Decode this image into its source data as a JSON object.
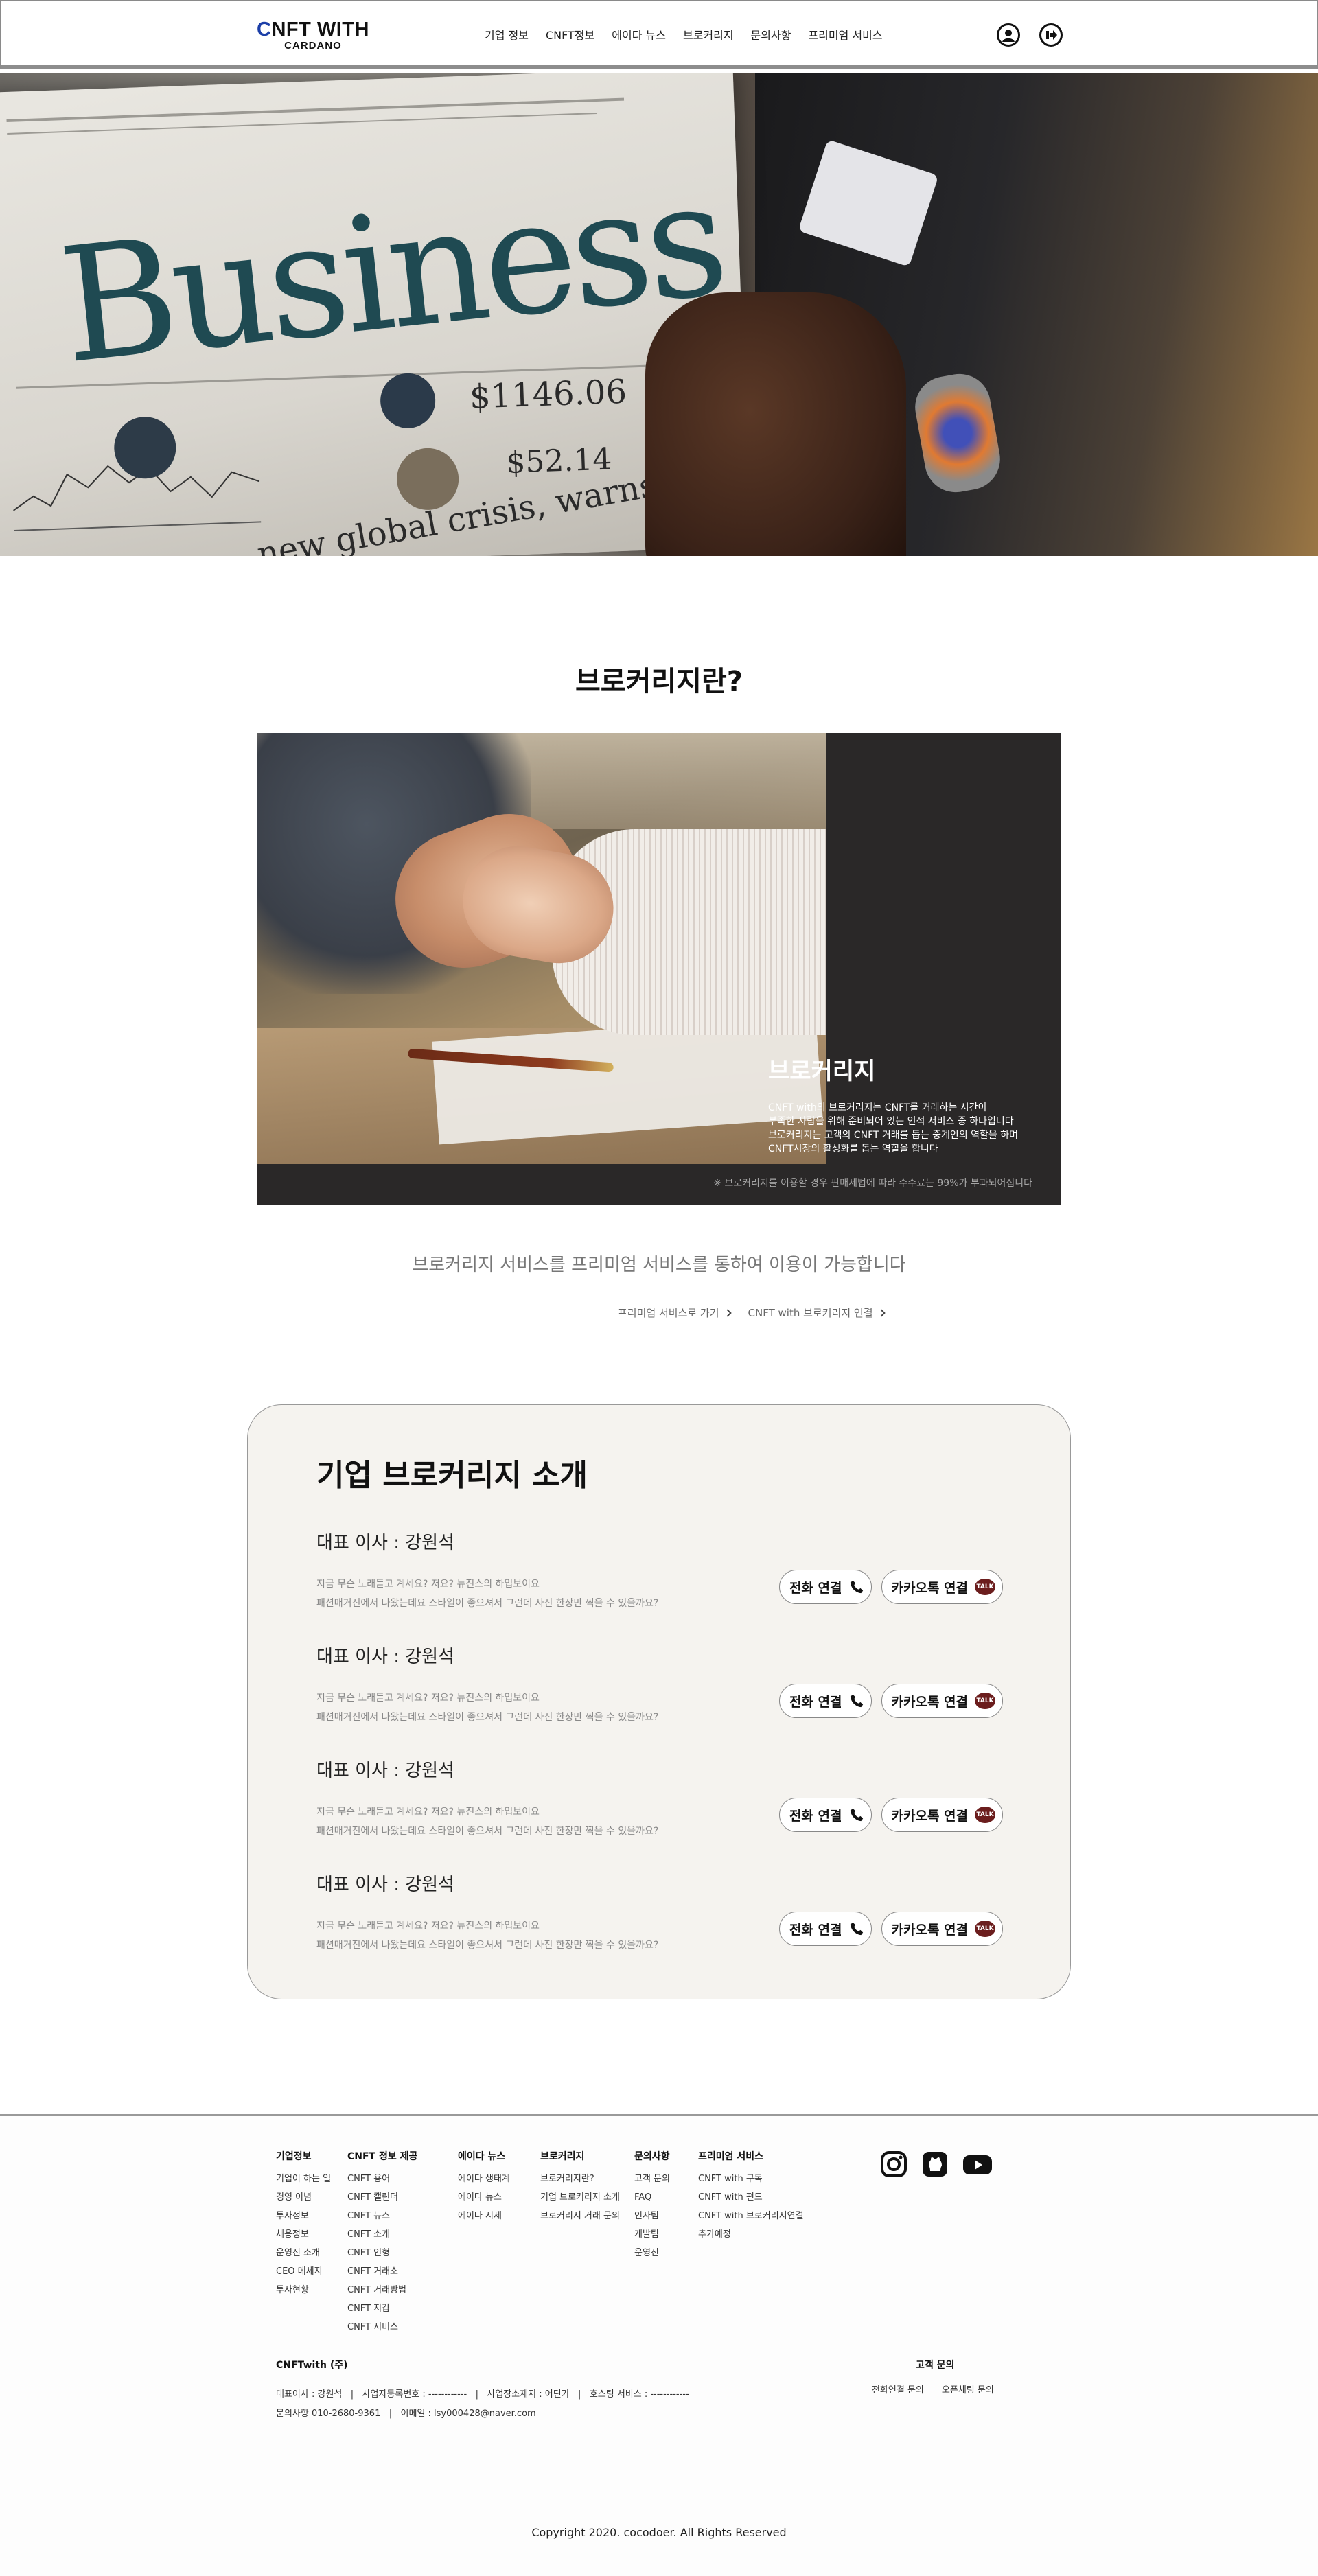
{
  "header": {
    "logo_main_c": "C",
    "logo_main_rest": "NFT WITH",
    "logo_sub": "CARDANO",
    "nav": [
      "기업 정보",
      "CNFT정보",
      "에이다 뉴스",
      "브로커리지",
      "문의사항",
      "프리미엄 서비스"
    ],
    "icons": [
      "user-icon",
      "logout-icon"
    ]
  },
  "hero": {
    "newspaper_word": "Business",
    "headline": "new global crisis, warns IMF",
    "number1": "$1146.06",
    "number2": "$52.14"
  },
  "brokerage": {
    "title": "브로커리지란?",
    "heading": "브로커리지",
    "desc_lines": [
      "CNFT with의 브로커리지는 CNFT를 거래하는 시간이",
      "부족한 사람을 위해 준비되어 있는 인적 서비스 중 하나입니다",
      "브로커리지는 고객의 CNFT 거래를 돕는 중계인의 역할을 하며",
      "CNFT시장의 활성화를 돕는 역할을 합니다"
    ],
    "note": "※ 브로커리지를 이용할 경우 판매세법에 따라 수수료는 99%가 부과되어집니다",
    "subline": "브로커리지 서비스를 프리미엄 서비스를 통하여 이용이 가능합니다",
    "link_premium": "프리미엄 서비스로 가기",
    "link_broker": "CNFT with 브로커리지 연결"
  },
  "corporate": {
    "title": "기업 브로커리지 소개",
    "people": [
      {
        "name": "대표 이사 : 강원석",
        "line1": "지금 무슨 노래듣고 계세요? 저요? 뉴진스의 하입보이요",
        "line2": "패션매거진에서 나왔는데요 스타일이 좋으셔서 그런데 사진 한장만 찍을 수 있을까요?"
      },
      {
        "name": "대표 이사 : 강원석",
        "line1": "지금 무슨 노래듣고 계세요? 저요? 뉴진스의 하입보이요",
        "line2": "패션매거진에서 나왔는데요 스타일이 좋으셔서 그런데 사진 한장만 찍을 수 있을까요?"
      },
      {
        "name": "대표 이사 : 강원석",
        "line1": "지금 무슨 노래듣고 계세요? 저요? 뉴진스의 하입보이요",
        "line2": "패션매거진에서 나왔는데요 스타일이 좋으셔서 그런데 사진 한장만 찍을 수 있을까요?"
      },
      {
        "name": "대표 이사 : 강원석",
        "line1": "지금 무슨 노래듣고 계세요? 저요? 뉴진스의 하입보이요",
        "line2": "패션매거진에서 나왔는데요 스타일이 좋으셔서 그런데 사진 한장만 찍을 수 있을까요?"
      }
    ],
    "phone_label": "전화 연결",
    "kakao_label": "카카오톡 연결",
    "talk_icon_text": "TALK"
  },
  "footer": {
    "columns": [
      {
        "title": "기업정보",
        "items": [
          "기업이 하는 일",
          "경영 이념",
          "투자정보",
          "채용정보",
          "운영진 소개",
          "CEO 메세지",
          "투자현황"
        ]
      },
      {
        "title": "CNFT 정보 제공",
        "items": [
          "CNFT 용어",
          "CNFT 캘린더",
          "CNFT 뉴스",
          "CNFT 소개",
          "CNFT 인형",
          "CNFT 거래소",
          "CNFT 거래방법",
          "CNFT 지갑",
          "CNFT 서비스"
        ]
      },
      {
        "title": "에이다 뉴스",
        "items": [
          "에이다 생태계",
          "에이다 뉴스",
          "에이다 시세"
        ]
      },
      {
        "title": "브로커리지",
        "items": [
          "브로커리지란?",
          "기업 브로커리지 소개",
          "브로커리지 거래 문의"
        ]
      },
      {
        "title": "문의사항",
        "items": [
          "고객 문의",
          "FAQ",
          "인사팀",
          "개발팀",
          "운영진"
        ]
      },
      {
        "title": "프리미엄 서비스",
        "items": [
          "CNFT with 구독",
          "CNFT with 펀드",
          "CNFT with 브로커리지연결",
          "추가예정"
        ]
      }
    ],
    "socials": [
      "instagram-icon",
      "github-icon",
      "youtube-icon"
    ],
    "company": "CNFTwith (주)",
    "info_line1": "대표이사 : 강원석   |   사업자등록번호 : ------------   |   사업장소재지 : 어딘가   |   호스팅 서비스 : ------------",
    "info_line2": "문의사항 010-2680-9361   |   이메일 : lsy000428@naver.com",
    "cs_title": "고객 문의",
    "cs_links": [
      "전화연결 문의",
      "오픈채팅 문의"
    ],
    "copyright": "Copyright 2020. cocodoer. All Rights Reserved"
  }
}
